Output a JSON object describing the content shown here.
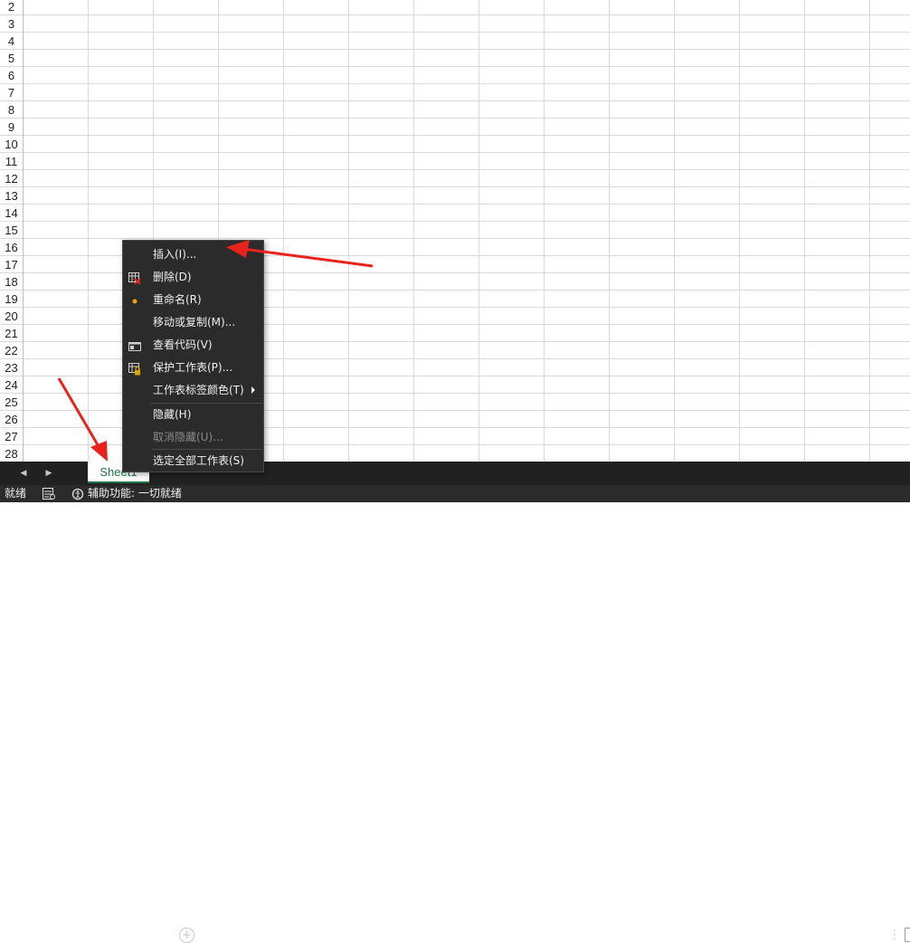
{
  "grid": {
    "row_numbers": [
      "2",
      "3",
      "4",
      "5",
      "6",
      "7",
      "8",
      "9",
      "10",
      "11",
      "12",
      "13",
      "14",
      "15",
      "16",
      "17",
      "18",
      "19",
      "20",
      "21",
      "22",
      "23",
      "24",
      "25",
      "26",
      "27",
      "28"
    ]
  },
  "sheet_tabs": [
    {
      "label": "Sheet1",
      "active": true
    }
  ],
  "context_menu": {
    "items": [
      {
        "label": "插入(I)...",
        "icon": null,
        "disabled": false
      },
      {
        "label": "删除(D)",
        "icon": "delete-sheet-icon",
        "disabled": false
      },
      {
        "label": "重命名(R)",
        "icon": "rename-dot-icon",
        "disabled": false
      },
      {
        "label": "移动或复制(M)...",
        "icon": null,
        "disabled": false
      },
      {
        "label": "查看代码(V)",
        "icon": "view-code-icon",
        "disabled": false
      },
      {
        "label": "保护工作表(P)...",
        "icon": "protect-sheet-icon",
        "disabled": false
      },
      {
        "label": "工作表标签颜色(T)",
        "icon": null,
        "disabled": false,
        "submenu": true
      },
      {
        "label": "隐藏(H)",
        "icon": null,
        "disabled": false
      },
      {
        "label": "取消隐藏(U)...",
        "icon": null,
        "disabled": true
      },
      {
        "label": "选定全部工作表(S)",
        "icon": null,
        "disabled": false
      }
    ]
  },
  "status_bar": {
    "ready": "就绪",
    "accessibility": "辅助功能: 一切就绪"
  },
  "icons": {
    "nav_prev": "chevron-left-icon",
    "nav_next": "chevron-right-icon",
    "add_sheet": "plus-circle-icon",
    "more": "more-vertical-icon",
    "macro": "macro-record-icon",
    "accessibility": "accessibility-check-icon"
  },
  "colors": {
    "accent": "#217346",
    "annotation_arrow": "#e8231b",
    "menu_bg": "#2b2b2b",
    "tabbar_bg": "#212121"
  }
}
